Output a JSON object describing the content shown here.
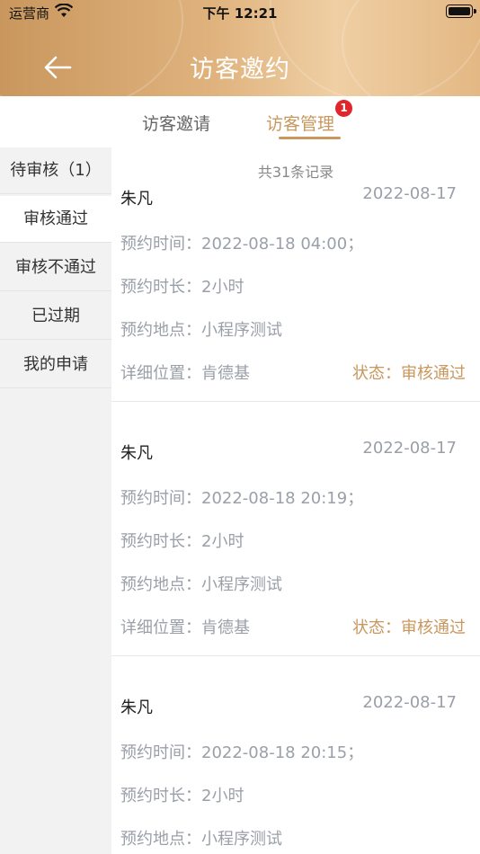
{
  "status_bar": {
    "carrier": "运营商",
    "time": "下午 12:21"
  },
  "header": {
    "title": "访客邀约"
  },
  "tabs": [
    {
      "label": "访客邀请"
    },
    {
      "label": "访客管理",
      "badge": "1"
    }
  ],
  "sidebar": {
    "items": [
      {
        "label": "待审核（1）"
      },
      {
        "label": "审核通过"
      },
      {
        "label": "审核不通过"
      },
      {
        "label": "已过期"
      },
      {
        "label": "我的申请"
      }
    ]
  },
  "list": {
    "total": "共31条记录",
    "labels": {
      "time": "预约时间：",
      "duration": "预约时长：",
      "place": "预约地点：",
      "location": "详细位置：",
      "status": "状态："
    },
    "records": [
      {
        "name": "朱凡",
        "date": "2022-08-17",
        "time": "2022-08-18 04:00；",
        "duration": "2小时",
        "place": "小程序测试",
        "location": "肯德基",
        "status": "审核通过"
      },
      {
        "name": "朱凡",
        "date": "2022-08-17",
        "time": "2022-08-18 20:19；",
        "duration": "2小时",
        "place": "小程序测试",
        "location": "肯德基",
        "status": "审核通过"
      },
      {
        "name": "朱凡",
        "date": "2022-08-17",
        "time": "2022-08-18 20:15；",
        "duration": "2小时",
        "place": "小程序测试"
      }
    ]
  },
  "colors": {
    "accent": "#c9975e",
    "badge": "#e0262d"
  }
}
